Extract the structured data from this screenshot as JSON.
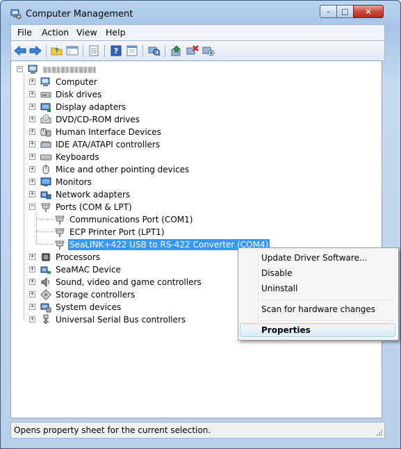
{
  "window": {
    "title": "Computer Management"
  },
  "window_controls": {
    "minimize": "–",
    "maximize": "□",
    "close": "✕"
  },
  "menubar": {
    "items": [
      "File",
      "Action",
      "View",
      "Help"
    ]
  },
  "toolbar": {
    "buttons": [
      "back-icon",
      "forward-icon",
      "up-folder-icon",
      "show-hide-console-tree-icon",
      "export-list-icon",
      "help-icon",
      "properties-icon",
      "scan-hardware-icon",
      "update-driver-icon",
      "uninstall-icon",
      "disable-icon"
    ]
  },
  "tree": {
    "root": {
      "label": ""
    },
    "categories": [
      {
        "label": "Computer",
        "icon": "computer-icon"
      },
      {
        "label": "Disk drives",
        "icon": "disk-drive-icon"
      },
      {
        "label": "Display adapters",
        "icon": "display-adapter-icon"
      },
      {
        "label": "DVD/CD-ROM drives",
        "icon": "dvd-drive-icon"
      },
      {
        "label": "Human Interface Devices",
        "icon": "hid-icon"
      },
      {
        "label": "IDE ATA/ATAPI controllers",
        "icon": "ide-controller-icon"
      },
      {
        "label": "Keyboards",
        "icon": "keyboard-icon"
      },
      {
        "label": "Mice and other pointing devices",
        "icon": "mouse-icon"
      },
      {
        "label": "Monitors",
        "icon": "monitor-icon"
      },
      {
        "label": "Network adapters",
        "icon": "network-adapter-icon"
      },
      {
        "label": "Ports (COM & LPT)",
        "icon": "port-icon"
      }
    ],
    "ports_children": [
      {
        "label": "Communications Port (COM1)",
        "icon": "port-icon"
      },
      {
        "label": "ECP Printer Port (LPT1)",
        "icon": "port-icon"
      },
      {
        "label": "SeaLINK+422 USB to RS-422 Converter (COM4)",
        "icon": "port-icon",
        "selected": true
      }
    ],
    "categories_after": [
      {
        "label": "Processors",
        "icon": "processor-icon"
      },
      {
        "label": "SeaMAC Device",
        "icon": "seamac-icon"
      },
      {
        "label": "Sound, video and game controllers",
        "icon": "sound-icon"
      },
      {
        "label": "Storage controllers",
        "icon": "storage-icon"
      },
      {
        "label": "System devices",
        "icon": "system-devices-icon"
      },
      {
        "label": "Universal Serial Bus controllers",
        "icon": "usb-icon"
      }
    ]
  },
  "context_menu": {
    "items": [
      "Update Driver Software...",
      "Disable",
      "Uninstall",
      "Scan for hardware changes",
      "Properties"
    ],
    "highlighted": "Properties"
  },
  "statusbar": {
    "text": "Opens property sheet for the current selection."
  },
  "colors": {
    "selection": "#3399ff",
    "title_bar": "#b8d3ee",
    "close_button": "#c9483a"
  }
}
